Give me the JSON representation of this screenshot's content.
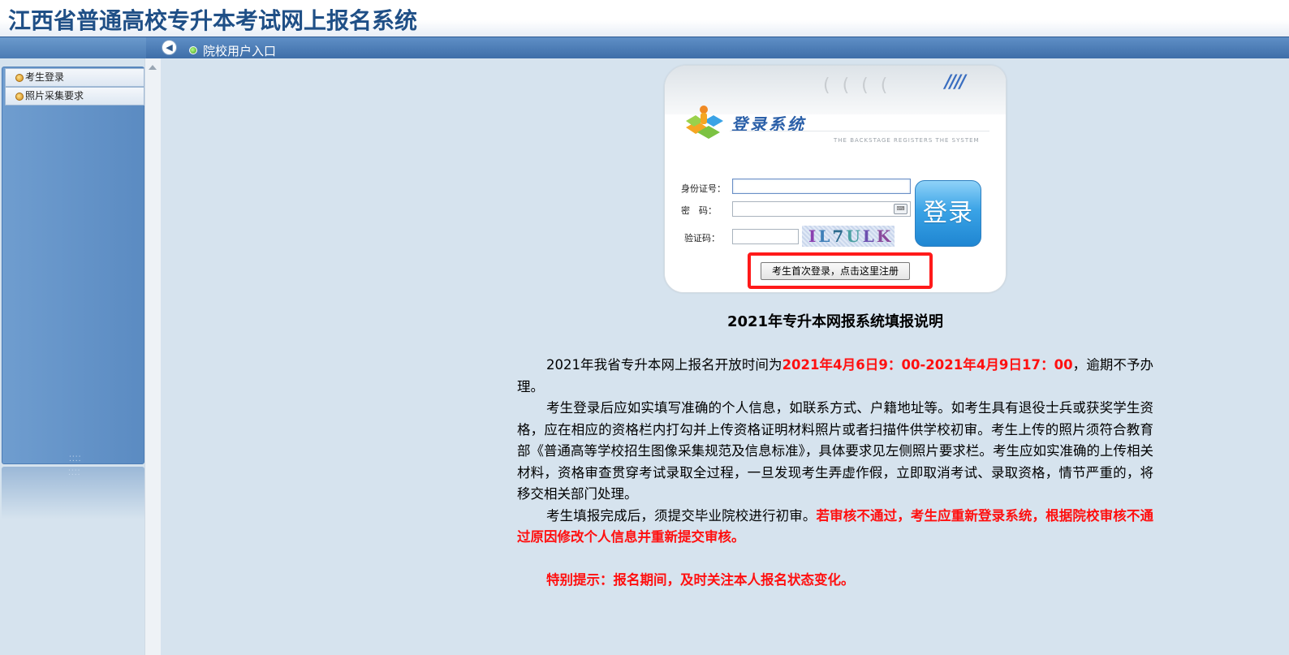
{
  "header": {
    "title": "江西省普通高校专升本考试网上报名系统"
  },
  "navbar": {
    "collapse_icon": "left-arrow-icon",
    "link_label": "院校用户入口"
  },
  "sidebar": {
    "items": [
      {
        "label": "考生登录"
      },
      {
        "label": "照片采集要求"
      }
    ]
  },
  "login": {
    "title": "登录系统",
    "subtitle": "THE BACKSTAGE REGISTERS THE SYSTEM",
    "id_label": "身份证号：",
    "id_value": "",
    "password_label": "密　码：",
    "password_value": "",
    "captcha_label": "验证码：",
    "captcha_value": "",
    "captcha_text": [
      "I",
      "L",
      "7",
      "U",
      "L",
      "K"
    ],
    "submit_label": "登录",
    "register_label": "考生首次登录，点击这里注册"
  },
  "instructions": {
    "title": "2021年专升本网报系统填报说明",
    "p1_before": "2021年我省专升本网上报名开放时间为",
    "p1_highlight": "2021年4月6日9：00-2021年4月9日17：00",
    "p1_after": "，逾期不予办理。",
    "p2": "考生登录后应如实填写准确的个人信息，如联系方式、户籍地址等。如考生具有退役士兵或获奖学生资格，应在相应的资格栏内打勾并上传资格证明材料照片或者扫描件供学校初审。考生上传的照片须符合教育部《普通高等学校招生图像采集规范及信息标准》，具体要求见左侧照片要求栏。考生应如实准确的上传相关材料，资格审查贯穿考试录取全过程，一旦发现考生弄虚作假，立即取消考试、录取资格，情节严重的，将移交相关部门处理。",
    "p3_before": "考生填报完成后，须提交毕业院校进行初审。",
    "p3_highlight": "若审核不通过，考生应重新登录系统，根据院校审核不通过原因修改个人信息并重新提交审核。",
    "tip": "特别提示：报名期间，及时关注本人报名状态变化。"
  },
  "colors": {
    "header_title": "#1f4f86",
    "navbar": "#4a7ab3",
    "highlight_red": "#ff1010",
    "register_border": "#ff1a1a",
    "login_button": "#2a94dc"
  }
}
